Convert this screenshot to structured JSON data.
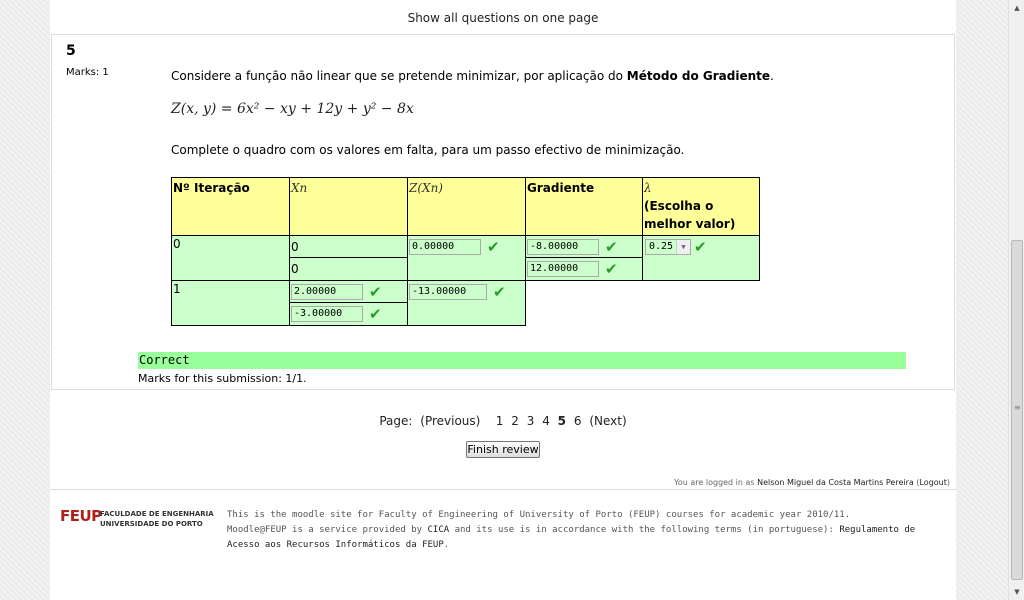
{
  "header": {
    "show_all": "Show all questions on one page"
  },
  "question": {
    "number": "5",
    "marks": "Marks: 1",
    "text_prefix": "Considere a função não linear que se pretende minimizar, por aplicação do ",
    "text_method": "Método do Gradiente",
    "text_suffix": ".",
    "formula": "Z(x, y) = 6x² − xy + 12y + y² − 8x",
    "instruction": "Complete o quadro com os valores em falta, para um passo efectivo de minimização."
  },
  "table": {
    "headers": {
      "iter": "Nº Iteração",
      "xn": "Xn",
      "zxn": "Z(Xn)",
      "grad": "Gradiente",
      "lambda": "λ",
      "lambda_note": "(Escolha o melhor valor)"
    },
    "row0": {
      "iter": "0",
      "x1": "0",
      "x2": "0",
      "z": "0.00000",
      "g1": "-8.00000",
      "g2": "12.00000",
      "lambda": "0.25"
    },
    "row1": {
      "iter": "1",
      "x1": "2.00000",
      "x2": "-3.00000",
      "z": "-13.00000"
    }
  },
  "feedback": {
    "status": "Correct",
    "marks": "Marks for this submission: 1/1."
  },
  "pager": {
    "label": "Page:",
    "previous": "(Previous)",
    "pages": [
      "1",
      "2",
      "3",
      "4",
      "5",
      "6"
    ],
    "current": "5",
    "next": "(Next)"
  },
  "finish_label": "Finish review",
  "login": {
    "prefix": "You are logged in as",
    "user": "Nelson Miguel da Costa Martins Pereira",
    "logout": "Logout"
  },
  "footer": {
    "logo_text": "FEUP",
    "logo_line1": "FACULDADE DE ENGENHARIA",
    "logo_line2": "UNIVERSIDADE DO PORTO",
    "line1": "This is the moodle site for Faculty of Engineering of University of Porto (FEUP) courses for academic year 2010/11.",
    "line2_a": "Moodle@FEUP is a service provided by ",
    "line2_cica": "CICA",
    "line2_b": " and its use is in accordance with the following terms (in portuguese): ",
    "line2_link": "Regulamento de Acesso aos Recursos Informáticos da FEUP",
    "line2_end": "."
  },
  "colors": {
    "header_cell": "#ffff99",
    "answer_cell": "#ccffcc",
    "correct_bar": "#99ff99",
    "tick": "#2a9a2a"
  },
  "icons": {
    "tick": "check-icon",
    "dropdown": "chevron-down-icon"
  }
}
